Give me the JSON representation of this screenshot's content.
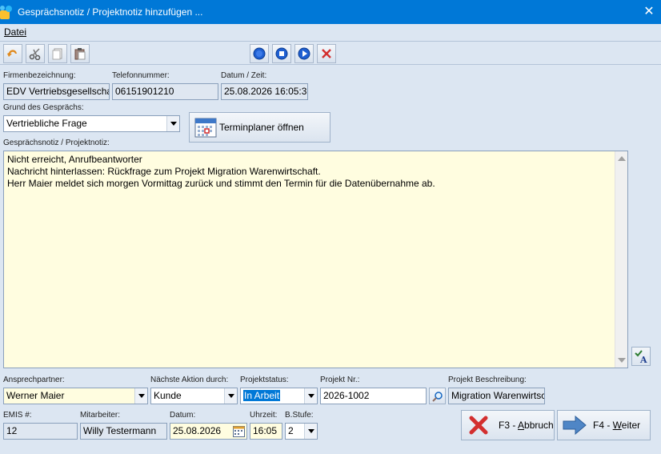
{
  "window": {
    "title": "Gesprächsnotiz / Projektnotiz hinzufügen ...",
    "close": "✕"
  },
  "menu": {
    "datei": "Datei"
  },
  "form": {
    "firma_label": "Firmenbezeichnung:",
    "firma_value": "EDV Vertriebsgesellschaft",
    "telefon_label": "Telefonnummer:",
    "telefon_value": "06151901210",
    "datum_zeit_label": "Datum / Zeit:",
    "datum_zeit_value": "25.08.2026 16:05:3",
    "grund_label": "Grund des Gesprächs:",
    "grund_value": "Vertriebliche Frage",
    "terminplaner_label": "Terminplaner öffnen",
    "notiz_label": "Gesprächsnotiz / Projektnotiz:",
    "notiz_text": "Nicht erreicht, Anrufbeantworter\nNachricht hinterlassen: Rückfrage zum Projekt Migration Warenwirtschaft.\nHerr Maier meldet sich morgen Vormittag zurück und stimmt den Termin für die Datenübernahme ab.",
    "ansprechpartner_label": "Ansprechpartner:",
    "ansprechpartner_value": "Werner Maier",
    "naechste_aktion_label": "Nächste Aktion durch:",
    "naechste_aktion_value": "Kunde",
    "projektstatus_label": "Projektstatus:",
    "projektstatus_value": "In Arbeit",
    "projektnr_label": "Projekt Nr.:",
    "projektnr_value": "2026-1002",
    "projektbeschr_label": "Projekt Beschreibung:",
    "projektbeschr_value": "Migration Warenwirtschaft",
    "emis_label": "EMIS #:",
    "emis_value": "12",
    "mitarbeiter_label": "Mitarbeiter:",
    "mitarbeiter_value": "Willy Testermann",
    "datum_label": "Datum:",
    "datum_value": "25.08.2026",
    "uhrzeit_label": "Uhrzeit:",
    "uhrzeit_value": "16:05",
    "bstufe_label": "B.Stufe:",
    "bstufe_value": "2"
  },
  "buttons": {
    "abbruch_prefix": "F3 - ",
    "abbruch_key": "A",
    "abbruch_rest": "bbruch",
    "weiter_prefix": "F4 - ",
    "weiter_key": "W",
    "weiter_rest": "eiter"
  },
  "colors": {
    "titlebar": "#0078d7",
    "background": "#dce6f2",
    "note_bg": "#fffde0"
  }
}
